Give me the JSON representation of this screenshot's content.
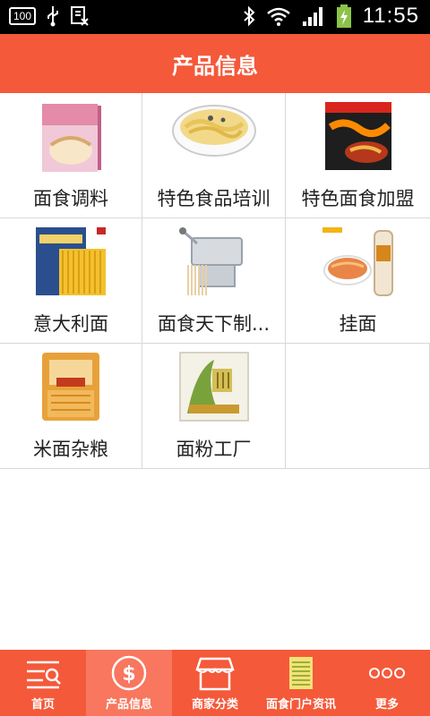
{
  "status_bar": {
    "battery_text": "100",
    "time": "11:55"
  },
  "header": {
    "title": "产品信息"
  },
  "products": [
    {
      "label": "面食调料"
    },
    {
      "label": "特色食品培训"
    },
    {
      "label": "特色面食加盟"
    },
    {
      "label": "意大利面"
    },
    {
      "label": "面食天下制..."
    },
    {
      "label": "挂面"
    },
    {
      "label": "米面杂粮"
    },
    {
      "label": "面粉工厂"
    }
  ],
  "nav": [
    {
      "label": "首页",
      "icon": "home-search-icon"
    },
    {
      "label": "产品信息",
      "icon": "dollar-circle-icon",
      "active": true
    },
    {
      "label": "商家分类",
      "icon": "store-icon"
    },
    {
      "label": "面食门户资讯",
      "icon": "document-icon"
    },
    {
      "label": "更多",
      "icon": "more-dots-icon"
    }
  ],
  "colors": {
    "brand": "#f4593a",
    "active_tab": "#f8775e"
  }
}
